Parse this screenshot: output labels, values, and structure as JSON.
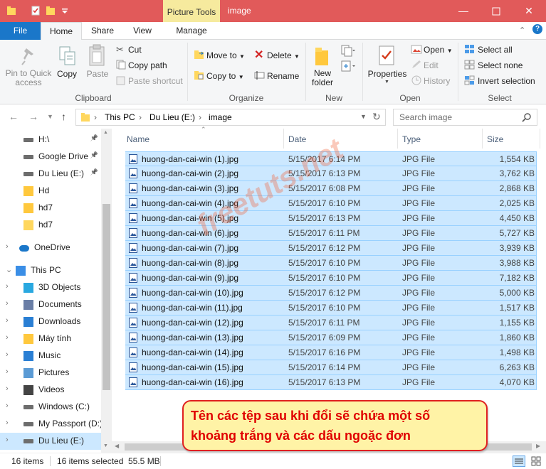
{
  "window": {
    "title": "image",
    "context_tab": "Picture Tools",
    "controls": [
      "minimize-icon",
      "maximize-icon",
      "close-icon"
    ],
    "title_color": "#e15a5a"
  },
  "tabs": [
    {
      "label": "File",
      "active": false
    },
    {
      "label": "Home",
      "active": true
    },
    {
      "label": "Share",
      "active": false
    },
    {
      "label": "View",
      "active": false
    },
    {
      "label": "Manage",
      "active": false
    }
  ],
  "ribbon": {
    "clipboard": {
      "group": "Clipboard",
      "pin_label": "Pin to Quick access",
      "copy_label": "Copy",
      "paste_label": "Paste",
      "cut_label": "Cut",
      "copy_path_label": "Copy path",
      "paste_shortcut_label": "Paste shortcut"
    },
    "organize": {
      "group": "Organize",
      "move_to": "Move to",
      "copy_to": "Copy to",
      "delete": "Delete",
      "rename": "Rename"
    },
    "new": {
      "group": "New",
      "new_folder": "New folder"
    },
    "open": {
      "group": "Open",
      "properties": "Properties",
      "open": "Open",
      "edit": "Edit",
      "history": "History"
    },
    "select": {
      "group": "Select",
      "select_all": "Select all",
      "select_none": "Select none",
      "invert": "Invert selection"
    }
  },
  "address": {
    "breadcrumb": [
      "This PC",
      "Du Lieu (E:)",
      "image"
    ],
    "search_placeholder": "Search image"
  },
  "nav": {
    "items": [
      {
        "label": "H:\\",
        "icon": "drive-icon",
        "pinned": true
      },
      {
        "label": "Google Drive",
        "icon": "drive-icon",
        "pinned": true
      },
      {
        "label": "Du Lieu (E:)",
        "icon": "drive-icon",
        "pinned": true
      },
      {
        "label": "Hd",
        "icon": "sync-folder-icon",
        "pinned": false
      },
      {
        "label": "hd7",
        "icon": "synced-folder-icon",
        "pinned": false
      },
      {
        "label": "hd7",
        "icon": "folder-icon",
        "pinned": false
      },
      {
        "label": "OneDrive",
        "icon": "cloud-icon",
        "pinned": false
      },
      {
        "label": "This PC",
        "icon": "computer-icon",
        "pinned": false
      },
      {
        "label": "3D Objects",
        "icon": "cube-icon",
        "pinned": false
      },
      {
        "label": "Documents",
        "icon": "document-icon",
        "pinned": false
      },
      {
        "label": "Downloads",
        "icon": "download-icon",
        "pinned": false
      },
      {
        "label": "Máy tính",
        "icon": "sync-folder-icon",
        "pinned": false
      },
      {
        "label": "Music",
        "icon": "music-icon",
        "pinned": false
      },
      {
        "label": "Pictures",
        "icon": "pictures-icon",
        "pinned": false
      },
      {
        "label": "Videos",
        "icon": "video-icon",
        "pinned": false
      },
      {
        "label": "Windows (C:)",
        "icon": "drive-icon",
        "pinned": false
      },
      {
        "label": "My Passport (D:)",
        "icon": "drive-icon",
        "pinned": false
      },
      {
        "label": "Du Lieu (E:)",
        "icon": "drive-icon",
        "pinned": false,
        "selected": true
      }
    ]
  },
  "list": {
    "columns": {
      "name": "Name",
      "date": "Date",
      "type": "Type",
      "size": "Size"
    },
    "rows": [
      {
        "name": "huong-dan-cai-win (1).jpg",
        "date": "5/15/2017 6:14 PM",
        "type": "JPG File",
        "size": "1,554 KB"
      },
      {
        "name": "huong-dan-cai-win (2).jpg",
        "date": "5/15/2017 6:13 PM",
        "type": "JPG File",
        "size": "3,762 KB"
      },
      {
        "name": "huong-dan-cai-win (3).jpg",
        "date": "5/15/2017 6:08 PM",
        "type": "JPG File",
        "size": "2,868 KB"
      },
      {
        "name": "huong-dan-cai-win (4).jpg",
        "date": "5/15/2017 6:10 PM",
        "type": "JPG File",
        "size": "2,025 KB"
      },
      {
        "name": "huong-dan-cai-win (5).jpg",
        "date": "5/15/2017 6:13 PM",
        "type": "JPG File",
        "size": "4,450 KB"
      },
      {
        "name": "huong-dan-cai-win (6).jpg",
        "date": "5/15/2017 6:11 PM",
        "type": "JPG File",
        "size": "5,727 KB"
      },
      {
        "name": "huong-dan-cai-win (7).jpg",
        "date": "5/15/2017 6:12 PM",
        "type": "JPG File",
        "size": "3,939 KB"
      },
      {
        "name": "huong-dan-cai-win (8).jpg",
        "date": "5/15/2017 6:10 PM",
        "type": "JPG File",
        "size": "3,988 KB"
      },
      {
        "name": "huong-dan-cai-win (9).jpg",
        "date": "5/15/2017 6:10 PM",
        "type": "JPG File",
        "size": "7,182 KB"
      },
      {
        "name": "huong-dan-cai-win (10).jpg",
        "date": "5/15/2017 6:12 PM",
        "type": "JPG File",
        "size": "5,000 KB"
      },
      {
        "name": "huong-dan-cai-win (11).jpg",
        "date": "5/15/2017 6:10 PM",
        "type": "JPG File",
        "size": "1,517 KB"
      },
      {
        "name": "huong-dan-cai-win (12).jpg",
        "date": "5/15/2017 6:11 PM",
        "type": "JPG File",
        "size": "1,155 KB"
      },
      {
        "name": "huong-dan-cai-win (13).jpg",
        "date": "5/15/2017 6:09 PM",
        "type": "JPG File",
        "size": "1,860 KB"
      },
      {
        "name": "huong-dan-cai-win (14).jpg",
        "date": "5/15/2017 6:16 PM",
        "type": "JPG File",
        "size": "1,498 KB"
      },
      {
        "name": "huong-dan-cai-win (15).jpg",
        "date": "5/15/2017 6:14 PM",
        "type": "JPG File",
        "size": "6,263 KB"
      },
      {
        "name": "huong-dan-cai-win (16).jpg",
        "date": "5/15/2017 6:13 PM",
        "type": "JPG File",
        "size": "4,070 KB"
      }
    ],
    "selection_color": "#cce8ff"
  },
  "status": {
    "items": "16 items",
    "selected": "16 items selected",
    "size": "55.5 MB"
  },
  "watermark": "freetuts.net",
  "callout": {
    "text": "Tên các tệp sau khi đổi sẽ chứa một số khoảng trắng và các dấu ngoặc đơn",
    "text_color": "#e00000",
    "background": "#fff3a6"
  }
}
